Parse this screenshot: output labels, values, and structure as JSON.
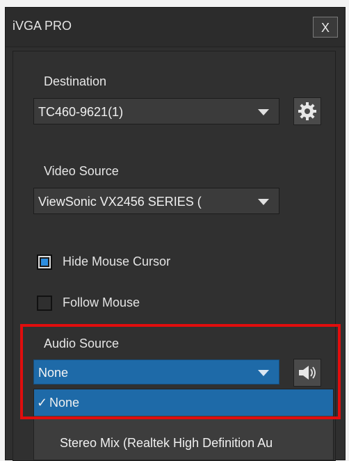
{
  "window": {
    "title": "iVGA PRO",
    "close_label": "X"
  },
  "destination": {
    "label": "Destination",
    "value": "TC460-9621(1)"
  },
  "video_source": {
    "label": "Video Source",
    "value": "ViewSonic VX2456 SERIES ("
  },
  "options": {
    "hide_cursor": {
      "label": "Hide Mouse Cursor",
      "checked": true
    },
    "follow_mouse": {
      "label": "Follow Mouse",
      "checked": false
    }
  },
  "audio_source": {
    "label": "Audio Source",
    "value": "None",
    "options": [
      {
        "label": "None",
        "selected": true,
        "check": "✓"
      },
      {
        "label": "Stereo Mix (Realtek High Definition Au",
        "selected": false
      }
    ]
  },
  "icons": {
    "settings": "gear-icon",
    "speaker": "speaker-icon"
  },
  "colors": {
    "accent": "#1e6aa8",
    "highlight": "#e00d0d",
    "checkbox_fill": "#2d8ee0"
  }
}
